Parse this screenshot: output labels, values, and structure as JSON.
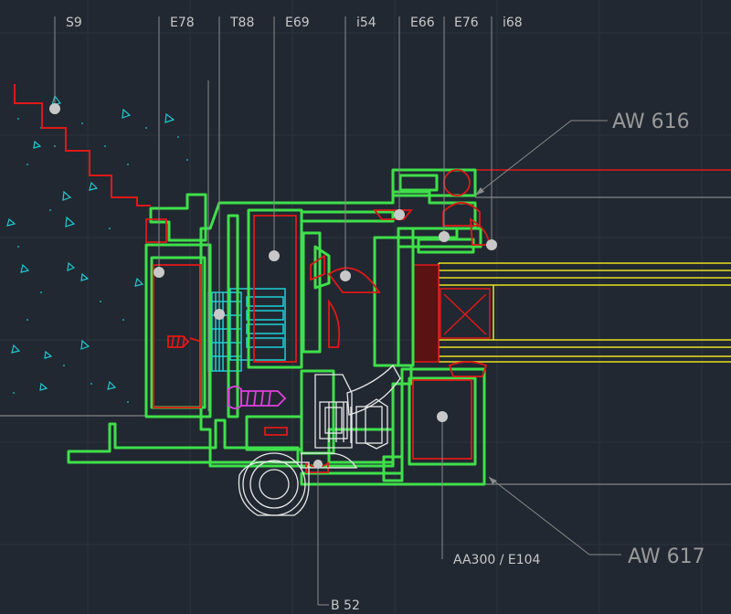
{
  "labels": {
    "s9": "S9",
    "e78": "E78",
    "t88": "T88",
    "e69": "E69",
    "i54": "i54",
    "e66": "E66",
    "e76": "E76",
    "i68": "i68",
    "aw616": "AW 616",
    "aw617": "AW 617",
    "aa300": "AA300 / E104",
    "b52": "B 52"
  },
  "colors": {
    "background": "#212831",
    "profile": "#3fe04a",
    "gasket": "#e01818",
    "glass": "#e8e020",
    "insulation": "#20d0d8",
    "screw": "#e040e0",
    "hardware": "#e8e8e8",
    "leader": "#8a8a8a",
    "marker": "#c8c8c8"
  }
}
